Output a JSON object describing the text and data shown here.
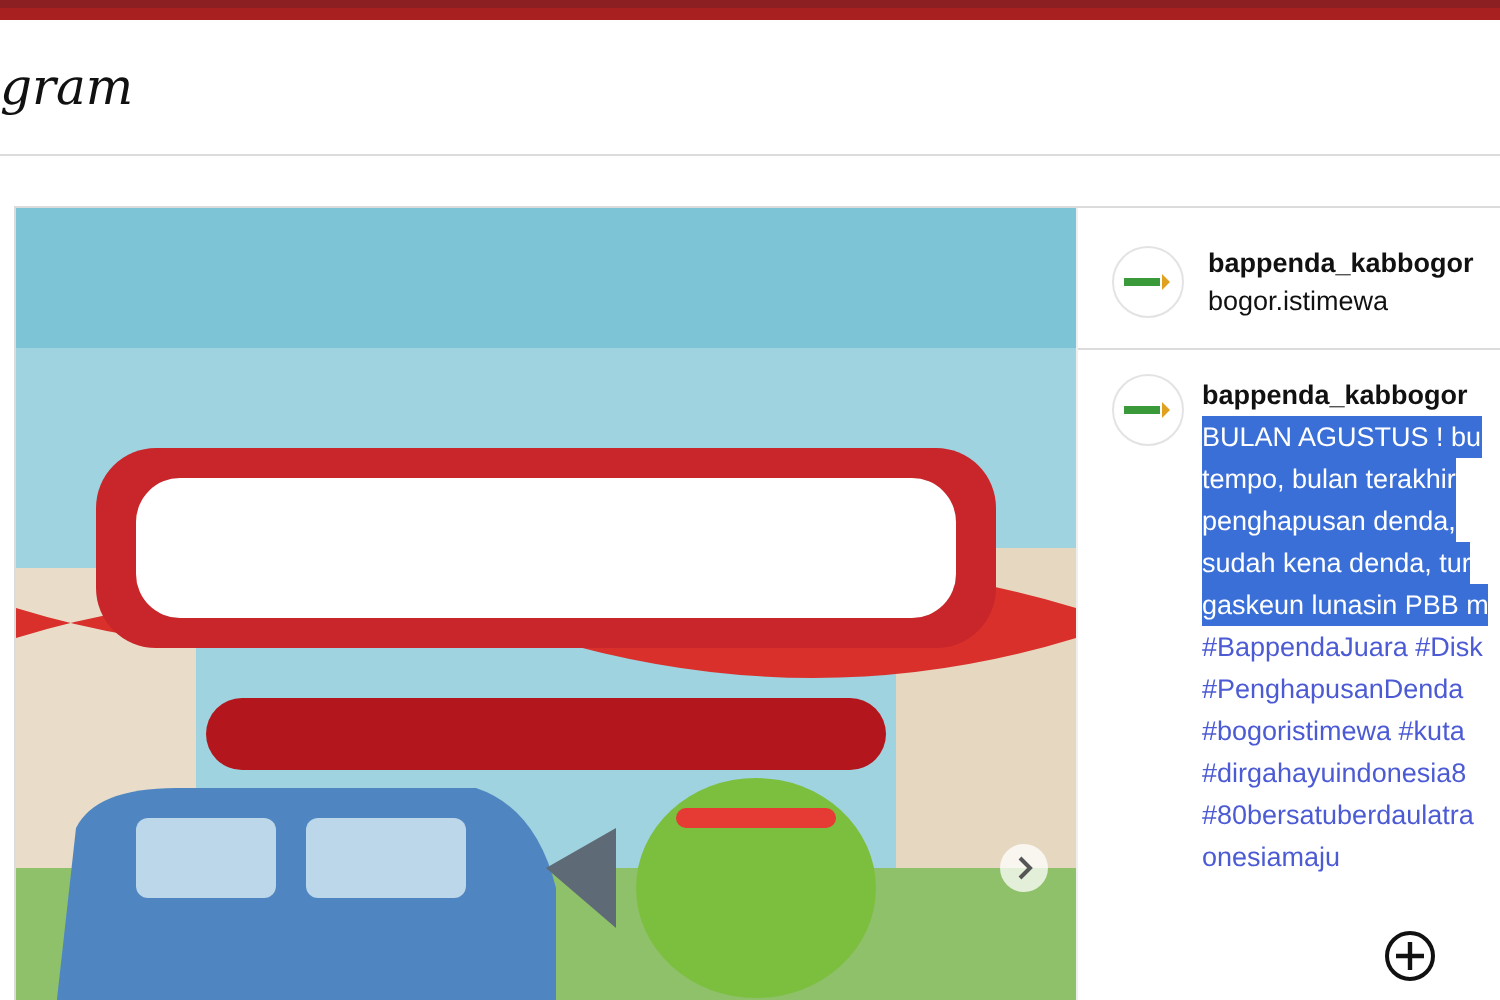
{
  "header": {
    "logo_text": "gram"
  },
  "post": {
    "carousel": {
      "has_next": true
    },
    "author": {
      "username": "bappenda_kabbogor",
      "location": "bogor.istimewa"
    },
    "caption": {
      "username": "bappenda_kabbogor",
      "lines": [
        {
          "text": "BULAN AGUSTUS ! bu",
          "kind": "text",
          "highlighted": true
        },
        {
          "text": "tempo, bulan terakhir",
          "kind": "text",
          "highlighted": true
        },
        {
          "text": "penghapusan denda,",
          "kind": "text",
          "highlighted": true
        },
        {
          "text": "sudah kena denda, tur",
          "kind": "text",
          "highlighted": true
        },
        {
          "text": "gaskeun lunasin PBB m",
          "kind": "text",
          "highlighted": true
        },
        {
          "text": "#BappendaJuara #Disk",
          "kind": "hashtag",
          "highlighted": false
        },
        {
          "text": "#PenghapusanDenda",
          "kind": "hashtag",
          "highlighted": false
        },
        {
          "text": "#bogoristimewa #kuta",
          "kind": "hashtag",
          "highlighted": false
        },
        {
          "text": "#dirgahayuindonesia8",
          "kind": "hashtag",
          "highlighted": false
        },
        {
          "text": "#80bersatuberdaulatra",
          "kind": "hashtag",
          "highlighted": false
        },
        {
          "text": "onesiamaju",
          "kind": "hashtag",
          "highlighted": false
        }
      ]
    }
  }
}
